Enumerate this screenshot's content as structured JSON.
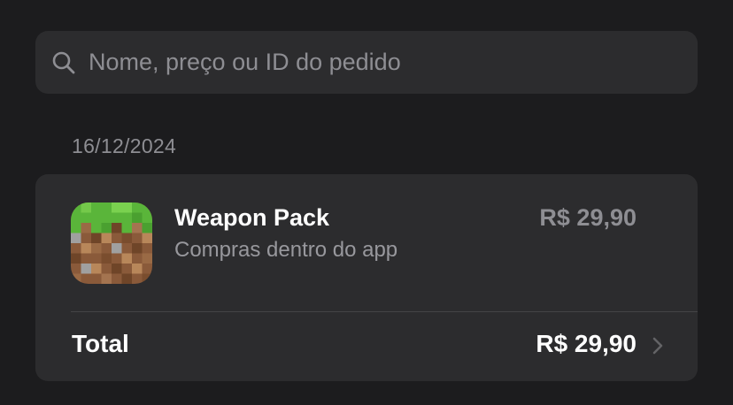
{
  "search": {
    "placeholder": "Nome, preço ou ID do pedido",
    "value": "",
    "icon": "search-icon"
  },
  "purchases": {
    "date": "16/12/2024",
    "item": {
      "title": "Weapon Pack",
      "subtitle": "Compras dentro do app",
      "price": "R$ 29,90",
      "icon": "minecraft-grass-block-icon"
    },
    "total": {
      "label": "Total",
      "value": "R$ 29,90",
      "icon": "chevron-right-icon"
    }
  },
  "colors": {
    "background": "#1c1c1e",
    "card": "#2c2c2e",
    "text_primary": "#ffffff",
    "text_secondary": "#8e8e93",
    "grass": "#5ab53a",
    "dirt": "#8a5a3a"
  }
}
